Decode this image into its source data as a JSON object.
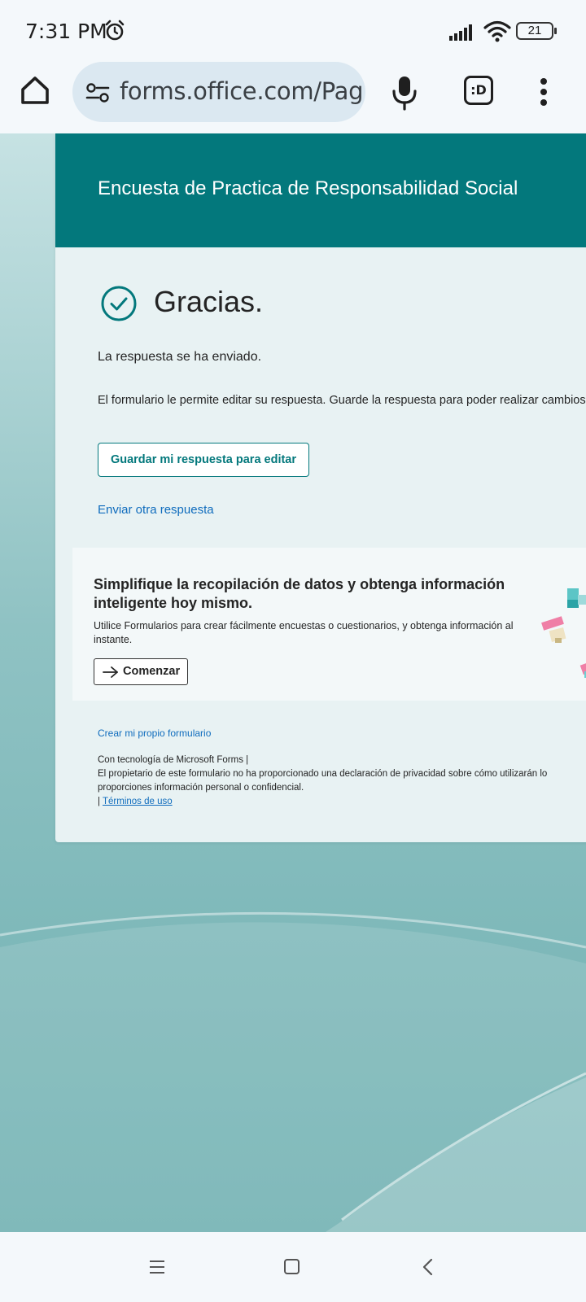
{
  "status_bar": {
    "time": "7:31 PM",
    "battery": "21"
  },
  "browser": {
    "url": "forms.office.com/Pag"
  },
  "form": {
    "title": "Encuesta de Practica de Responsabilidad Social",
    "thanks_heading": "Gracias.",
    "submitted_message": "La respuesta se ha enviado.",
    "edit_info": "El formulario le permite editar su respuesta. Guarde la respuesta para poder realizar cambios",
    "save_button": "Guardar mi respuesta para editar",
    "another_response_link": "Enviar otra respuesta"
  },
  "promo": {
    "title": "Simplifique la recopilación de datos y obtenga información inteligente hoy mismo.",
    "description": "Utilice Formularios para crear fácilmente encuestas o cuestionarios, y obtenga información al instante.",
    "start_button": "Comenzar"
  },
  "footer": {
    "create_link": "Crear mi propio formulario",
    "powered_by": "Con tecnología de Microsoft Forms |",
    "privacy_line1": "El propietario de este formulario no ha proporcionado una declaración de privacidad sobre cómo utilizarán lo",
    "privacy_line2": "proporciones información personal o confidencial.",
    "terms_prefix": "| ",
    "terms_link": "Términos de uso"
  },
  "colors": {
    "header_teal": "#03787c",
    "link_blue": "#0f6cbd",
    "background_teal": "#8fc2c3"
  },
  "icons": {
    "status": [
      "alarm-icon",
      "signal-icon",
      "wifi-icon",
      "battery-icon"
    ],
    "toolbar": [
      "home-icon",
      "site-settings-icon",
      "mic-icon",
      "tabs-icon",
      "more-icon"
    ],
    "nav": [
      "recents-icon",
      "home-nav-icon",
      "back-icon"
    ]
  }
}
